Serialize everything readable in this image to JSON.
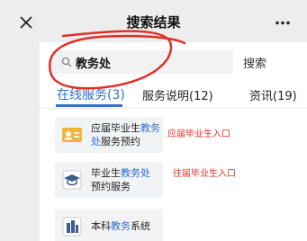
{
  "header": {
    "title": "搜索结果",
    "close_icon": "close-icon",
    "more_icon": "more-dots-icon"
  },
  "search": {
    "icon": "search-icon",
    "value": "教务处",
    "button_label": "搜索"
  },
  "tabs": [
    {
      "label": "在线服务(3)",
      "active": true
    },
    {
      "label": "服务说明(12)",
      "active": false
    },
    {
      "label": "资讯(19)",
      "active": false
    }
  ],
  "results": [
    {
      "icon": "id-card-icon",
      "title_parts": [
        "应届毕业生",
        "教务处",
        "服务预约"
      ],
      "annotation": "应届毕业生入口"
    },
    {
      "icon": "graduation-cap-icon",
      "title_parts": [
        "毕业生",
        "教务处",
        "预约服务"
      ],
      "annotation": "往届毕业生入口"
    },
    {
      "icon": "buildings-icon",
      "title_parts": [
        "本科",
        "教务",
        "系统"
      ],
      "annotation": ""
    }
  ],
  "colors": {
    "accent": "#2f6fd6",
    "annotation": "#e0302b"
  }
}
